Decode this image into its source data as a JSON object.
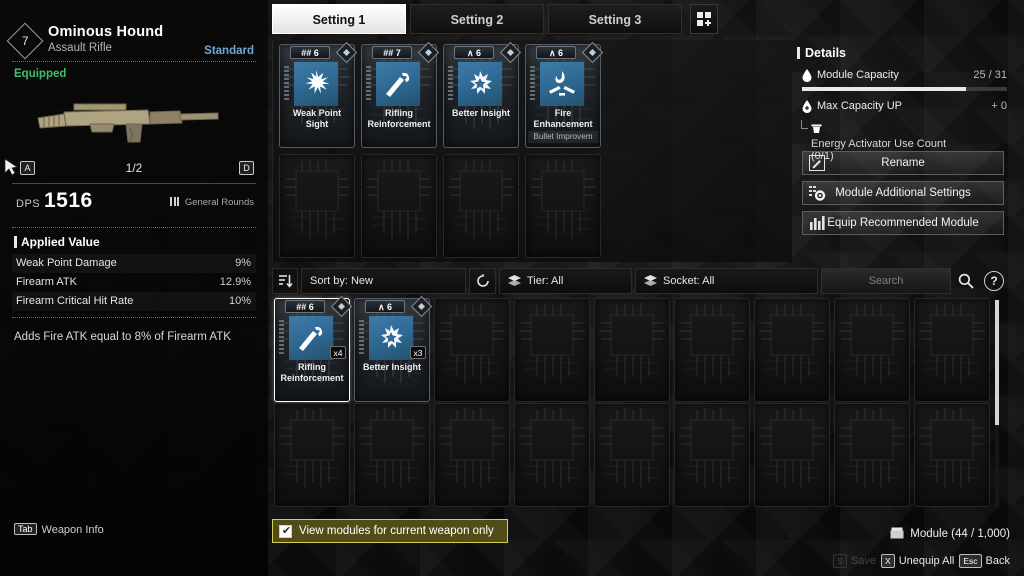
{
  "weapon": {
    "level": "7",
    "name": "Ominous Hound",
    "type": "Assault Rifle",
    "rarity": "Standard",
    "status": "Equipped",
    "page": "1/2",
    "prev_key": "A",
    "next_key": "D",
    "dps_label": "DPS",
    "dps_value": "1516",
    "ammo_type": "General Rounds",
    "applied_value_title": "Applied Value",
    "stats": [
      {
        "name": "Weak Point Damage",
        "value": "9%"
      },
      {
        "name": "Firearm ATK",
        "value": "12.9%"
      },
      {
        "name": "Firearm Critical Hit Rate",
        "value": "10%"
      }
    ],
    "description": "Adds Fire ATK equal to 8% of Firearm ATK",
    "info_key": "Tab",
    "info_label": "Weapon Info"
  },
  "tabs": [
    {
      "label": "Setting 1",
      "active": true
    },
    {
      "label": "Setting 2",
      "active": false
    },
    {
      "label": "Setting 3",
      "active": false
    }
  ],
  "tab_add_icon": "grid-plus-icon",
  "equipped_modules": [
    {
      "capacity": "6",
      "tier_mark": "W",
      "name": "Weak Point Sight",
      "sub": "",
      "icon": "burst-icon",
      "empty": false
    },
    {
      "capacity": "7",
      "tier_mark": "W",
      "name": "Rifling Reinforcement",
      "sub": "",
      "icon": "barrel-icon",
      "empty": false
    },
    {
      "capacity": "6",
      "tier_mark": "A",
      "name": "Better Insight",
      "sub": "",
      "icon": "shatter-icon",
      "empty": false
    },
    {
      "capacity": "6",
      "tier_mark": "A",
      "name": "Fire Enhancement",
      "sub": "Bullet Improvem",
      "icon": "flame-blade-icon",
      "empty": false
    },
    {
      "empty": true
    },
    {
      "empty": true
    },
    {
      "empty": true
    },
    {
      "empty": true
    }
  ],
  "details": {
    "title": "Details",
    "module_capacity_label": "Module Capacity",
    "module_capacity_value": "25 / 31",
    "module_capacity_percent": 80,
    "max_capacity_label": "Max Capacity UP",
    "max_capacity_value": "+ 0",
    "energy_activator_label": "Energy Activator Use Count",
    "energy_activator_value": "(0/1)",
    "buttons": [
      {
        "label": "Rename",
        "icon": "pencil-icon"
      },
      {
        "label": "Module Additional Settings",
        "icon": "gear-icon"
      },
      {
        "label": "Equip Recommended Module",
        "icon": "bar-chart-icon"
      }
    ]
  },
  "filterbar": {
    "sort_icon": "sort-descending-icon",
    "sort_label": "Sort by: New",
    "reset_icon": "refresh-icon",
    "tier_label": "Tier: All",
    "socket_label": "Socket: All",
    "search_placeholder": "Search",
    "search_value": "",
    "search_icon": "magnifier-icon",
    "help_label": "?"
  },
  "inventory": [
    {
      "capacity": "6",
      "tier_mark": "W",
      "name": "Rifling Reinforcement",
      "qty": "x4",
      "icon": "barrel-icon",
      "empty": false,
      "selected": true
    },
    {
      "capacity": "6",
      "tier_mark": "A",
      "name": "Better Insight",
      "qty": "x3",
      "icon": "shatter-icon",
      "empty": false,
      "selected": false
    },
    {
      "empty": true
    },
    {
      "empty": true
    },
    {
      "empty": true
    },
    {
      "empty": true
    },
    {
      "empty": true
    },
    {
      "empty": true
    },
    {
      "empty": true
    },
    {
      "empty": true
    },
    {
      "empty": true
    },
    {
      "empty": true
    },
    {
      "empty": true
    },
    {
      "empty": true
    },
    {
      "empty": true
    },
    {
      "empty": true
    },
    {
      "empty": true
    },
    {
      "empty": true
    }
  ],
  "bottom": {
    "checkbox_label": "View modules for current weapon only",
    "checkbox_checked": true,
    "module_count": "Module (44 / 1,000)",
    "module_icon": "box-icon",
    "keys": [
      {
        "cap": "S",
        "label": "Save",
        "disabled": true
      },
      {
        "cap": "X",
        "label": "Unequip All",
        "disabled": false
      },
      {
        "cap": "Esc",
        "label": "Back",
        "disabled": false
      }
    ]
  },
  "colors": {
    "accent_blue": "#6fa8d8",
    "equipped_green": "#3fbf6a",
    "checkbox_olive": "#524d18",
    "checkbox_border": "#d6cf5c",
    "module_icon_blue": "#3f7ba8"
  }
}
